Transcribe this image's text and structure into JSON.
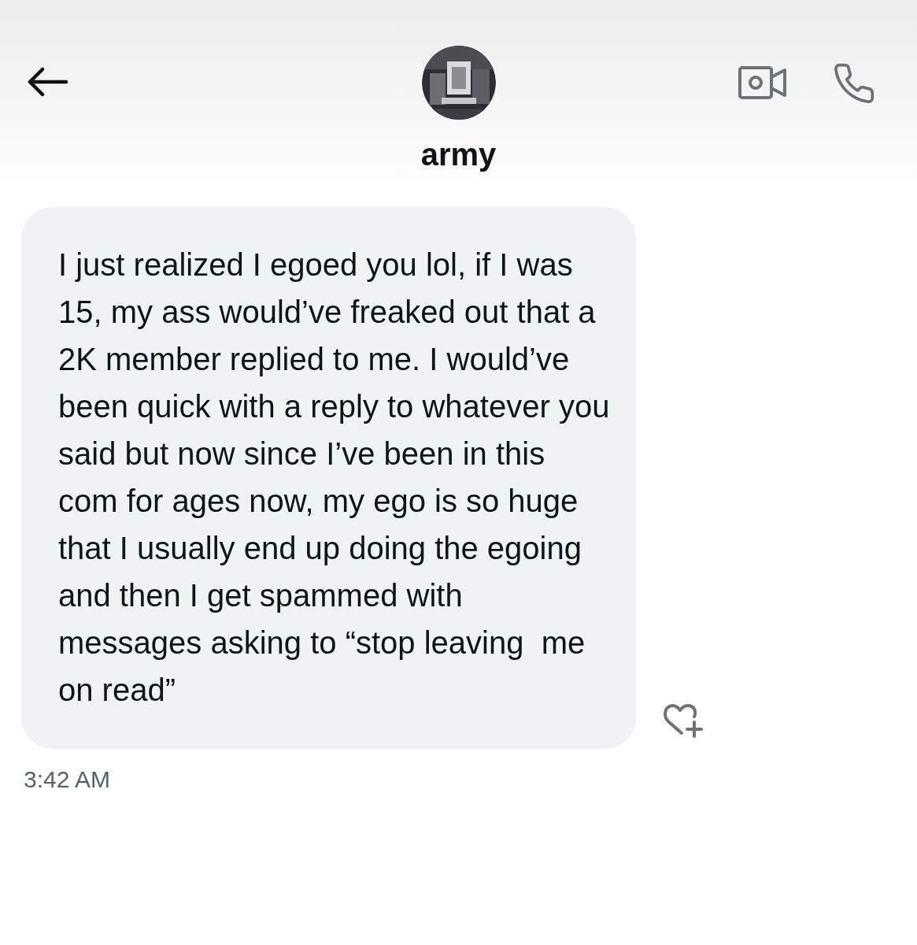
{
  "header": {
    "name": "army"
  },
  "messages": [
    {
      "text": "I just realized I egoed you lol, if I was 15, my ass would’ve freaked out that a 2K member replied to me. I would’ve been quick with a reply to whatever you said but now since I’ve been in this com for ages now, my ego is so huge that I usually end up doing the egoing and then I get spammed with messages asking to “stop leaving  me on read”",
      "time": "3:42 AM"
    }
  ]
}
